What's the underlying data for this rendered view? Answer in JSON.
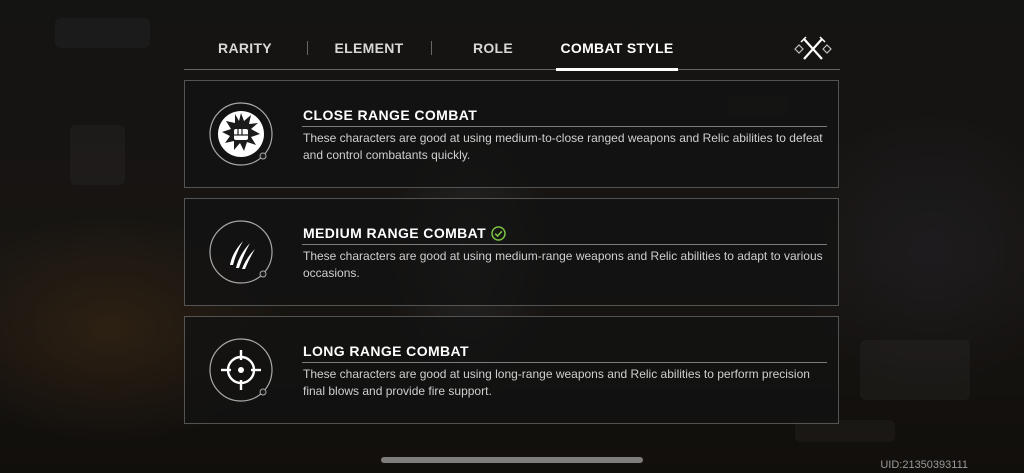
{
  "tabs": [
    {
      "label": "RARITY",
      "active": false
    },
    {
      "label": "ELEMENT",
      "active": false
    },
    {
      "label": "ROLE",
      "active": false
    },
    {
      "label": "COMBAT STYLE",
      "active": true
    }
  ],
  "close_icon": "crossed-swords-close-icon",
  "cards": [
    {
      "title": "CLOSE RANGE COMBAT",
      "description": "These characters are good at using medium-to-close ranged weapons and Relic abilities to defeat and control combatants quickly.",
      "icon": "fist-icon",
      "selected": false
    },
    {
      "title": "MEDIUM RANGE COMBAT",
      "description": "These characters are good at using medium-range weapons and Relic abilities to adapt to various occasions.",
      "icon": "claw-slash-icon",
      "selected": true
    },
    {
      "title": "LONG RANGE COMBAT",
      "description": "These characters are good at using long-range weapons and Relic abilities to perform precision final blows and provide fire support.",
      "icon": "crosshair-icon",
      "selected": false
    }
  ],
  "uid_text": "UID:21350393111",
  "colors": {
    "accent_check": "#7cc442",
    "text_primary": "#ffffff",
    "card_border": "#5a5a5a"
  }
}
